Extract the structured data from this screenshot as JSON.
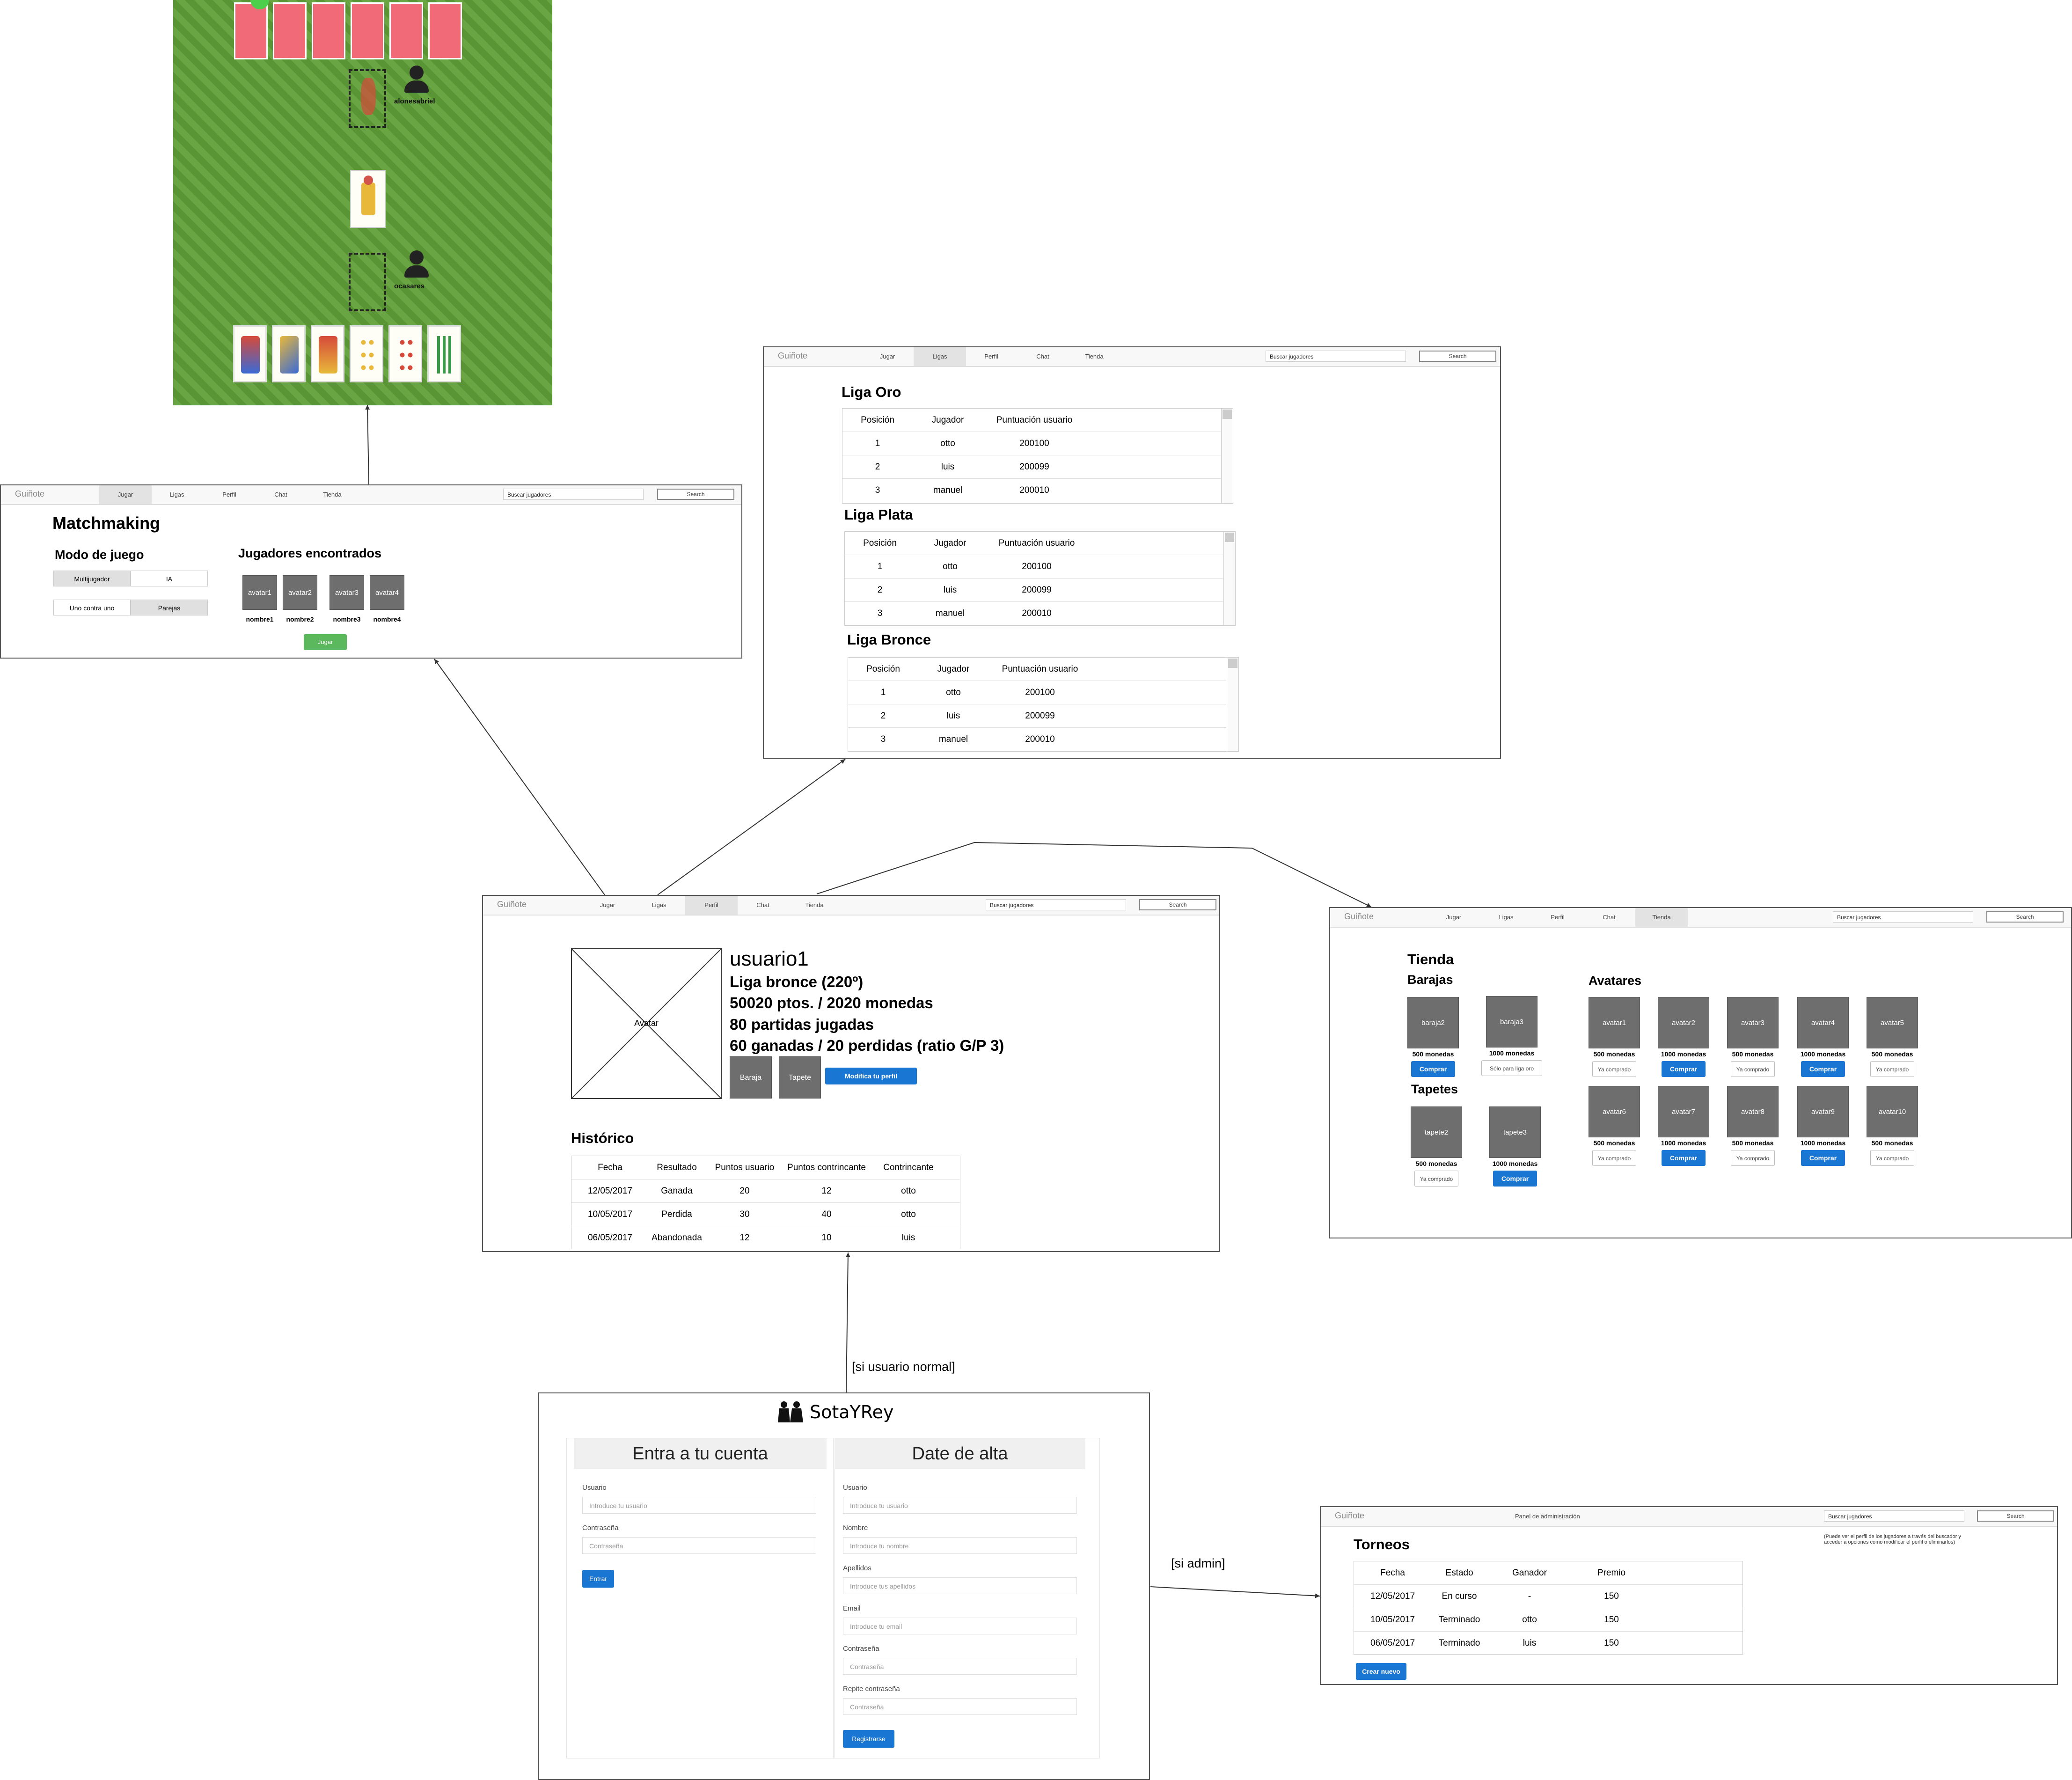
{
  "colors": {
    "accent_blue": "#1976d2",
    "accent_green": "#5cb85c",
    "card_back": "#f06a78",
    "felt": "#5f9a3a",
    "placeholder_grey": "#6e6e6e"
  },
  "game": {
    "player_top_name": "alonesabriel",
    "player_bottom_name": "ocasares",
    "icons": [
      "player-icon",
      "player-icon"
    ]
  },
  "nav_common": {
    "brand": "Guiñote",
    "items": [
      "Jugar",
      "Ligas",
      "Perfil",
      "Chat",
      "Tienda"
    ],
    "search_placeholder": "Buscar jugadores",
    "search_button": "Search"
  },
  "matchmaking": {
    "title": "Matchmaking",
    "mode_title": "Modo de juego",
    "mode_options": [
      "Multijugador",
      "IA"
    ],
    "team_options": [
      "Uno contra uno",
      "Parejas"
    ],
    "players_title": "Jugadores encontrados",
    "avatars": [
      "avatar1",
      "avatar2",
      "avatar3",
      "avatar4"
    ],
    "names": [
      "nombre1",
      "nombre2",
      "nombre3",
      "nombre4"
    ],
    "play_button": "Jugar"
  },
  "ligas": {
    "columns": [
      "Posición",
      "Jugador",
      "Puntuación usuario"
    ],
    "leagues": [
      {
        "title": "Liga Oro",
        "rows": [
          [
            "1",
            "otto",
            "200100"
          ],
          [
            "2",
            "luis",
            "200099"
          ],
          [
            "3",
            "manuel",
            "200010"
          ]
        ]
      },
      {
        "title": "Liga Plata",
        "rows": [
          [
            "1",
            "otto",
            "200100"
          ],
          [
            "2",
            "luis",
            "200099"
          ],
          [
            "3",
            "manuel",
            "200010"
          ]
        ]
      },
      {
        "title": "Liga Bronce",
        "rows": [
          [
            "1",
            "otto",
            "200100"
          ],
          [
            "2",
            "luis",
            "200099"
          ],
          [
            "3",
            "manuel",
            "200010"
          ]
        ]
      }
    ]
  },
  "perfil": {
    "avatar_label": "Avatar",
    "username": "usuario1",
    "stats": [
      "Liga bronce (220º)",
      "50020 ptos. / 2020 monedas",
      "80 partidas jugadas",
      "60 ganadas / 20 perdidas (ratio G/P 3)"
    ],
    "baraja_button": "Baraja",
    "tapete_button": "Tapete",
    "modify_button": "Modifica tu perfil",
    "history_title": "Histórico",
    "history_columns": [
      "Fecha",
      "Resultado",
      "Puntos usuario",
      "Puntos contrincante",
      "Contrincante"
    ],
    "history_rows": [
      [
        "12/05/2017",
        "Ganada",
        "20",
        "12",
        "otto"
      ],
      [
        "10/05/2017",
        "Perdida",
        "30",
        "40",
        "otto"
      ],
      [
        "06/05/2017",
        "Abandonada",
        "12",
        "10",
        "luis"
      ]
    ]
  },
  "tienda": {
    "title": "Tienda",
    "barajas_title": "Barajas",
    "barajas": [
      {
        "name": "baraja2",
        "price": "500 monedas",
        "action": "Comprar",
        "type": "buy"
      },
      {
        "name": "baraja3",
        "price": "1000 monedas",
        "action": "Sólo para liga oro",
        "type": "owned"
      }
    ],
    "tapetes_title": "Tapetes",
    "tapetes": [
      {
        "name": "tapete2",
        "price": "500 monedas",
        "action": "Ya comprado",
        "type": "owned"
      },
      {
        "name": "tapete3",
        "price": "1000 monedas",
        "action": "Comprar",
        "type": "buy"
      }
    ],
    "avatares_title": "Avatares",
    "avatares": [
      {
        "name": "avatar1",
        "price": "500 monedas",
        "action": "Ya comprado",
        "type": "owned"
      },
      {
        "name": "avatar2",
        "price": "1000 monedas",
        "action": "Comprar",
        "type": "buy"
      },
      {
        "name": "avatar3",
        "price": "500 monedas",
        "action": "Ya comprado",
        "type": "owned"
      },
      {
        "name": "avatar4",
        "price": "1000 monedas",
        "action": "Comprar",
        "type": "buy"
      },
      {
        "name": "avatar5",
        "price": "500 monedas",
        "action": "Ya comprado",
        "type": "owned"
      },
      {
        "name": "avatar6",
        "price": "500 monedas",
        "action": "Ya comprado",
        "type": "owned"
      },
      {
        "name": "avatar7",
        "price": "1000 monedas",
        "action": "Comprar",
        "type": "buy"
      },
      {
        "name": "avatar8",
        "price": "500 monedas",
        "action": "Ya comprado",
        "type": "owned"
      },
      {
        "name": "avatar9",
        "price": "1000 monedas",
        "action": "Comprar",
        "type": "buy"
      },
      {
        "name": "avatar10",
        "price": "500 monedas",
        "action": "Ya comprado",
        "type": "owned"
      }
    ]
  },
  "login": {
    "logo_text": "SotaYRey",
    "login_title": "Entra a tu cuenta",
    "login_fields": [
      {
        "label": "Usuario",
        "placeholder": "Introduce tu usuario"
      },
      {
        "label": "Contraseña",
        "placeholder": "Contraseña"
      }
    ],
    "login_button": "Entrar",
    "signup_title": "Date de alta",
    "signup_fields": [
      {
        "label": "Usuario",
        "placeholder": "Introduce tu usuario"
      },
      {
        "label": "Nombre",
        "placeholder": "Introduce tu nombre"
      },
      {
        "label": "Apellidos",
        "placeholder": "Introduce tus apellidos"
      },
      {
        "label": "Email",
        "placeholder": "Introduce tu email"
      },
      {
        "label": "Contraseña",
        "placeholder": "Contraseña"
      },
      {
        "label": "Repite contraseña",
        "placeholder": "Contraseña"
      }
    ],
    "signup_button": "Registrarse"
  },
  "admin": {
    "brand": "Guiñote",
    "panel_label": "Panel de administración",
    "search_placeholder": "Buscar jugadores",
    "search_button": "Search",
    "note": "(Puede ver el perfil de los jugadores a través del buscador y acceder a opciones como modificar el perfil o eliminarlos)",
    "title": "Torneos",
    "columns": [
      "Fecha",
      "Estado",
      "Ganador",
      "Premio"
    ],
    "rows": [
      [
        "12/05/2017",
        "En curso",
        "-",
        "150"
      ],
      [
        "10/05/2017",
        "Terminado",
        "otto",
        "150"
      ],
      [
        "06/05/2017",
        "Terminado",
        "luis",
        "150"
      ]
    ],
    "new_button": "Crear nuevo"
  },
  "edges": {
    "normal_user": "[si usuario normal]",
    "admin": "[si admin]"
  }
}
